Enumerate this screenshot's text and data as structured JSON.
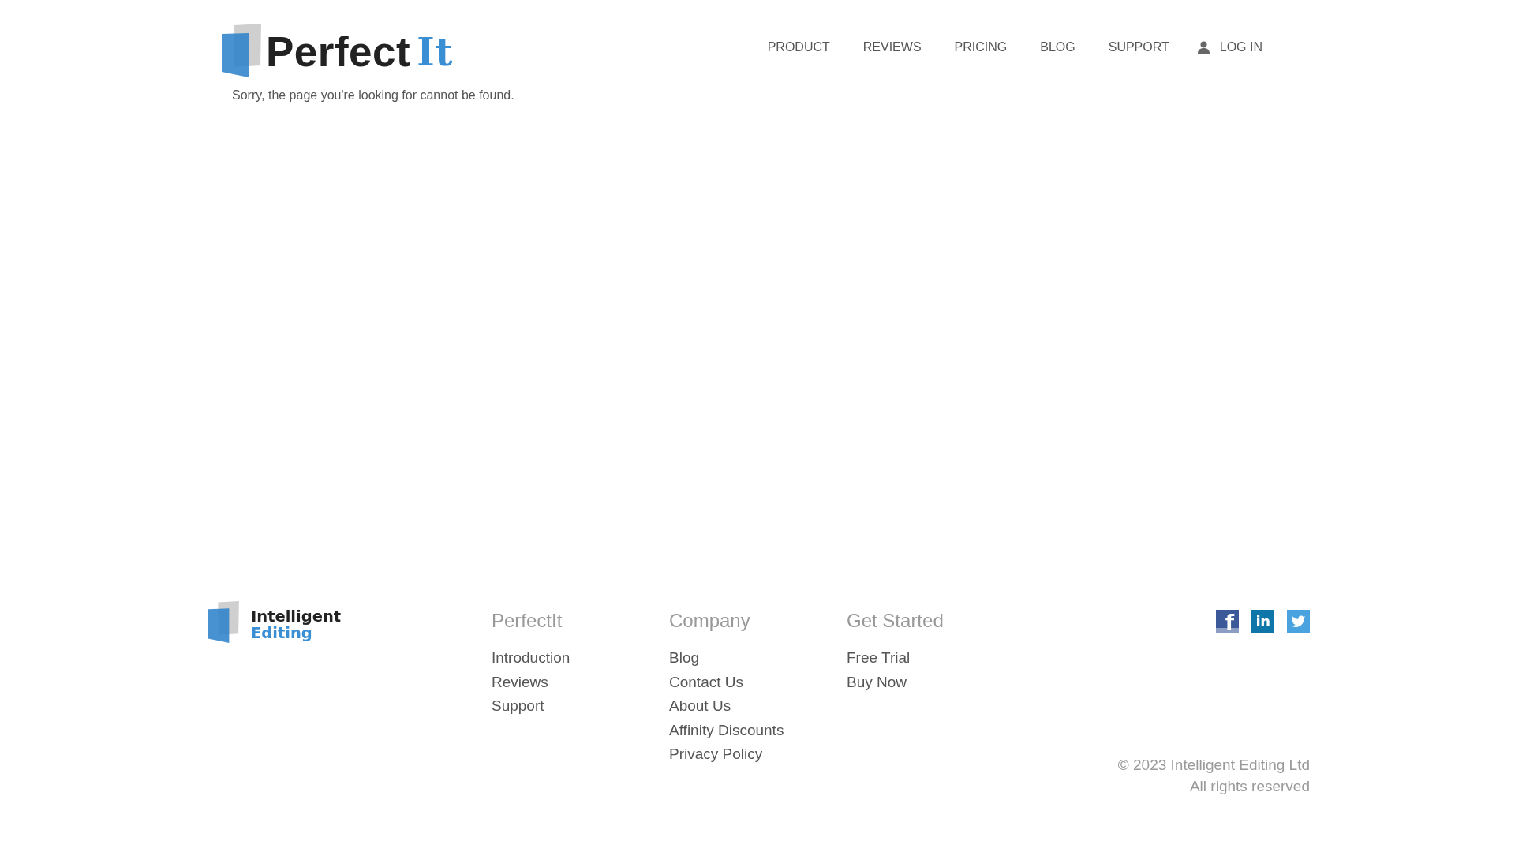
{
  "header": {
    "logo": {
      "name": "Perfect",
      "accent": "It"
    },
    "nav": [
      {
        "label": "PRODUCT",
        "kind": "link"
      },
      {
        "label": "REVIEWS",
        "kind": "link"
      },
      {
        "label": "PRICING",
        "kind": "link"
      },
      {
        "label": "BLOG",
        "kind": "link"
      },
      {
        "label": "SUPPORT",
        "kind": "link"
      },
      {
        "label": "LOG IN",
        "kind": "account"
      }
    ]
  },
  "message": "Sorry, the page you're looking for cannot be found.",
  "footer": {
    "logo": {
      "line_1": "Intelligent",
      "line_2": "Editing"
    },
    "columns": [
      {
        "heading": "PerfectIt",
        "links": [
          "Introduction",
          "Reviews",
          "Support"
        ]
      },
      {
        "heading": "Company",
        "links": [
          "Blog",
          "Contact Us",
          "About Us",
          "Affinity Discounts",
          "Privacy Policy"
        ]
      },
      {
        "heading": "Get Started",
        "links": [
          "Free Trial",
          "Buy Now"
        ]
      }
    ],
    "social": [
      {
        "kind": "facebook",
        "glyph": "f"
      },
      {
        "kind": "linkedin",
        "glyph": "in"
      },
      {
        "kind": "twitter"
      }
    ],
    "copyright": [
      "© 2023 Intelligent Editing Ltd",
      "All rights reserved"
    ]
  }
}
